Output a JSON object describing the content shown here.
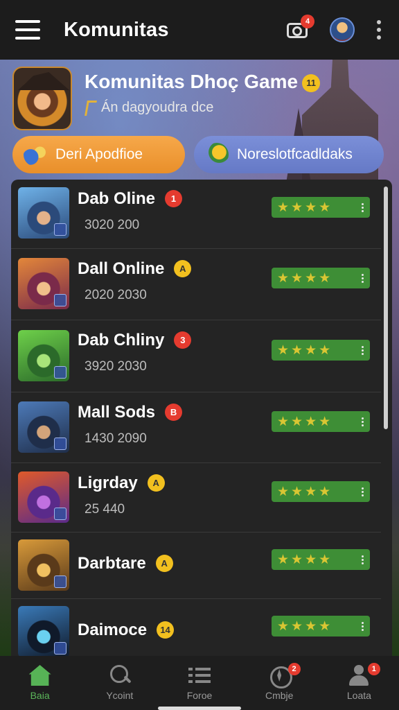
{
  "topbar": {
    "title": "Komunitas",
    "camera_badge": "4"
  },
  "community": {
    "title": "Komunitas  Dhoç Game",
    "badge": "11",
    "subtitle": "Án dagyoudra dce"
  },
  "actions": {
    "primary_label": "Deri Apodfioe",
    "secondary_label": "Noreslotfcadldaks"
  },
  "games": [
    {
      "name": "Dab Oline",
      "badge": "1",
      "badge_color": "#e53b2f",
      "meta": "3020  200",
      "rating_stars": 4,
      "thumb_colors": [
        "#6fb2e8",
        "#2b4a7a",
        "#e4b28a"
      ]
    },
    {
      "name": "Dall Online",
      "badge": "A",
      "badge_color": "#f2c01f",
      "meta": "2020  2030",
      "rating_stars": 4,
      "thumb_colors": [
        "#e3873a",
        "#7a2a4a",
        "#f0c08a"
      ]
    },
    {
      "name": "Dab Chliny",
      "badge": "3",
      "badge_color": "#e53b2f",
      "meta": "3920  2030",
      "rating_stars": 4,
      "thumb_colors": [
        "#6ed04a",
        "#2b6a2a",
        "#a8e47a"
      ]
    },
    {
      "name": "Mall Sods",
      "badge": "B",
      "badge_color": "#e53b2f",
      "meta": "1430  2090",
      "rating_stars": 4,
      "thumb_colors": [
        "#4d7ab8",
        "#1f2e4a",
        "#d3a47a"
      ]
    },
    {
      "name": "Ligrday",
      "badge": "A",
      "badge_color": "#f2c01f",
      "meta": "25 440",
      "rating_stars": 4,
      "thumb_colors": [
        "#e05a2a",
        "#5a2a8a",
        "#c070e0"
      ]
    },
    {
      "name": "Darbtare",
      "badge": "A",
      "badge_color": "#f2c01f",
      "meta": "",
      "rating_stars": 4,
      "thumb_colors": [
        "#d89a3a",
        "#5a3a1a",
        "#f0c060"
      ]
    },
    {
      "name": "Daimoce",
      "badge": "14",
      "badge_color": "#f2c01f",
      "meta": "",
      "rating_stars": 4,
      "thumb_colors": [
        "#3a7ab8",
        "#101a2a",
        "#6ad0f0"
      ]
    }
  ],
  "bottom_nav": [
    {
      "label": "Baia",
      "icon": "home-icon",
      "active": true,
      "badge": ""
    },
    {
      "label": "Ycoint",
      "icon": "search-icon",
      "active": false,
      "badge": ""
    },
    {
      "label": "Foroe",
      "icon": "list-icon",
      "active": false,
      "badge": ""
    },
    {
      "label": "Cmbje",
      "icon": "compass-icon",
      "active": false,
      "badge": "2"
    },
    {
      "label": "Loata",
      "icon": "person-icon",
      "active": false,
      "badge": "1"
    }
  ],
  "colors": {
    "accent_green": "#57b356",
    "pill_orange": "#f0a040",
    "pill_blue": "#6f83cf",
    "badge_red": "#e53b2f",
    "badge_yellow": "#f2c01f"
  }
}
